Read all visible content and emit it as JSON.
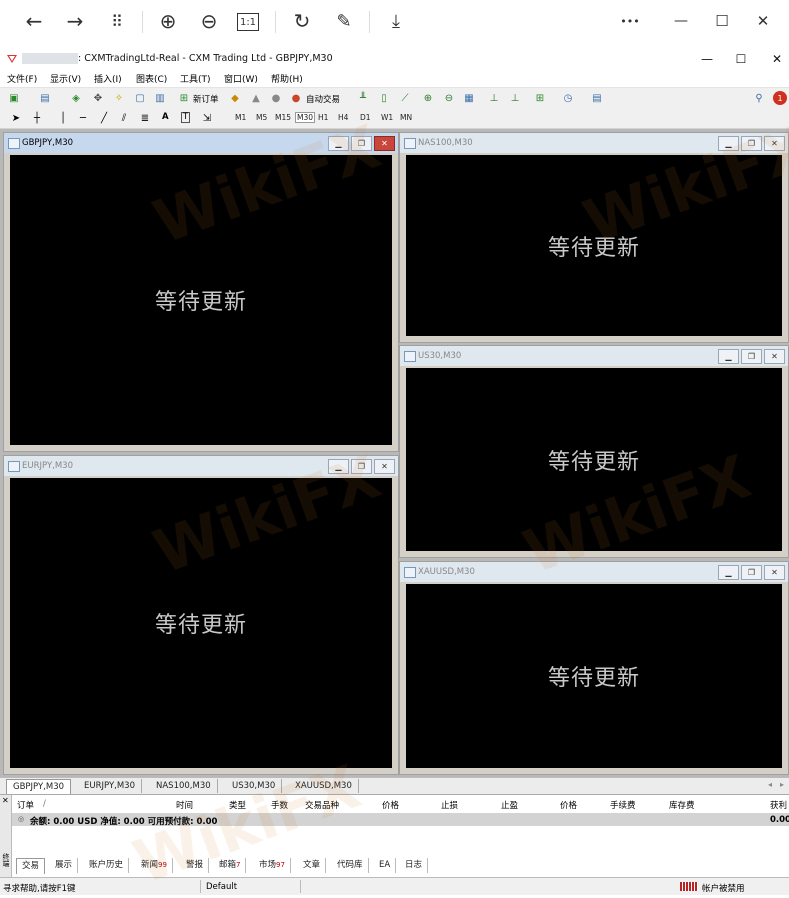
{
  "viewer": {
    "icons": [
      "back-arrow-icon",
      "forward-arrow-icon",
      "grid-icon",
      "zoom-in-icon",
      "zoom-out-icon",
      "actual-size-icon",
      "rotate-icon",
      "edit-icon",
      "download-icon",
      "more-icon",
      "minimize-icon",
      "maximize-icon",
      "close-icon"
    ],
    "glyphs": {
      "back": "←",
      "forward": "→",
      "grid": "⠿",
      "zoomin": "⊕",
      "zoomout": "⊖",
      "actual": "1:1",
      "rotate": "↻",
      "edit": "✎",
      "download": "⤓",
      "more": "•••",
      "min": "—",
      "max": "☐",
      "close": "✕"
    }
  },
  "app": {
    "title": ": CXMTradingLtd-Real - CXM Trading Ltd - GBPJPY,M30",
    "win_min": "—",
    "win_max": "☐",
    "win_close": "✕"
  },
  "menu": [
    "文件(F)",
    "显示(V)",
    "插入(I)",
    "图表(C)",
    "工具(T)",
    "窗口(W)",
    "帮助(H)"
  ],
  "toolbar": {
    "new_order": "新订单",
    "auto_trade": "自动交易",
    "timeframes": [
      "M1",
      "M5",
      "M15",
      "M30",
      "H1",
      "H4",
      "D1",
      "W1",
      "MN"
    ],
    "text_tool": "A",
    "label_tool": "T"
  },
  "charts": [
    {
      "title": "GBPJPY,M30",
      "status": "等待更新",
      "active": true
    },
    {
      "title": "NAS100,M30",
      "status": "等待更新",
      "active": false
    },
    {
      "title": "US30,M30",
      "status": "等待更新",
      "active": false
    },
    {
      "title": "EURJPY,M30",
      "status": "等待更新",
      "active": false
    },
    {
      "title": "XAUUSD,M30",
      "status": "等待更新",
      "active": false
    }
  ],
  "chart_tabs": [
    "GBPJPY,M30",
    "EURJPY,M30",
    "NAS100,M30",
    "US30,M30",
    "XAUUSD,M30"
  ],
  "terminal": {
    "columns": [
      "订单",
      "时间",
      "类型",
      "手数",
      "交易品种",
      "价格",
      "止损",
      "止盈",
      "价格",
      "手续费",
      "库存费",
      "获利"
    ],
    "sort_mark": "/",
    "balance_text": "余额: 0.00 USD  净值: 0.00  可用预付款: 0.00",
    "profit": "0.00",
    "side_label": "终端",
    "tabs": [
      {
        "label": "交易",
        "badge": ""
      },
      {
        "label": "展示",
        "badge": ""
      },
      {
        "label": "账户历史",
        "badge": ""
      },
      {
        "label": "新闻",
        "badge": "99"
      },
      {
        "label": "警报",
        "badge": ""
      },
      {
        "label": "邮箱",
        "badge": "7"
      },
      {
        "label": "市场",
        "badge": "97"
      },
      {
        "label": "文章",
        "badge": ""
      },
      {
        "label": "代码库",
        "badge": ""
      },
      {
        "label": "EA",
        "badge": ""
      },
      {
        "label": "日志",
        "badge": ""
      }
    ]
  },
  "status": {
    "help": "寻求帮助,请按F1键",
    "profile": "Default",
    "account": "帐户被禁用"
  },
  "watermark": "WikiFX"
}
